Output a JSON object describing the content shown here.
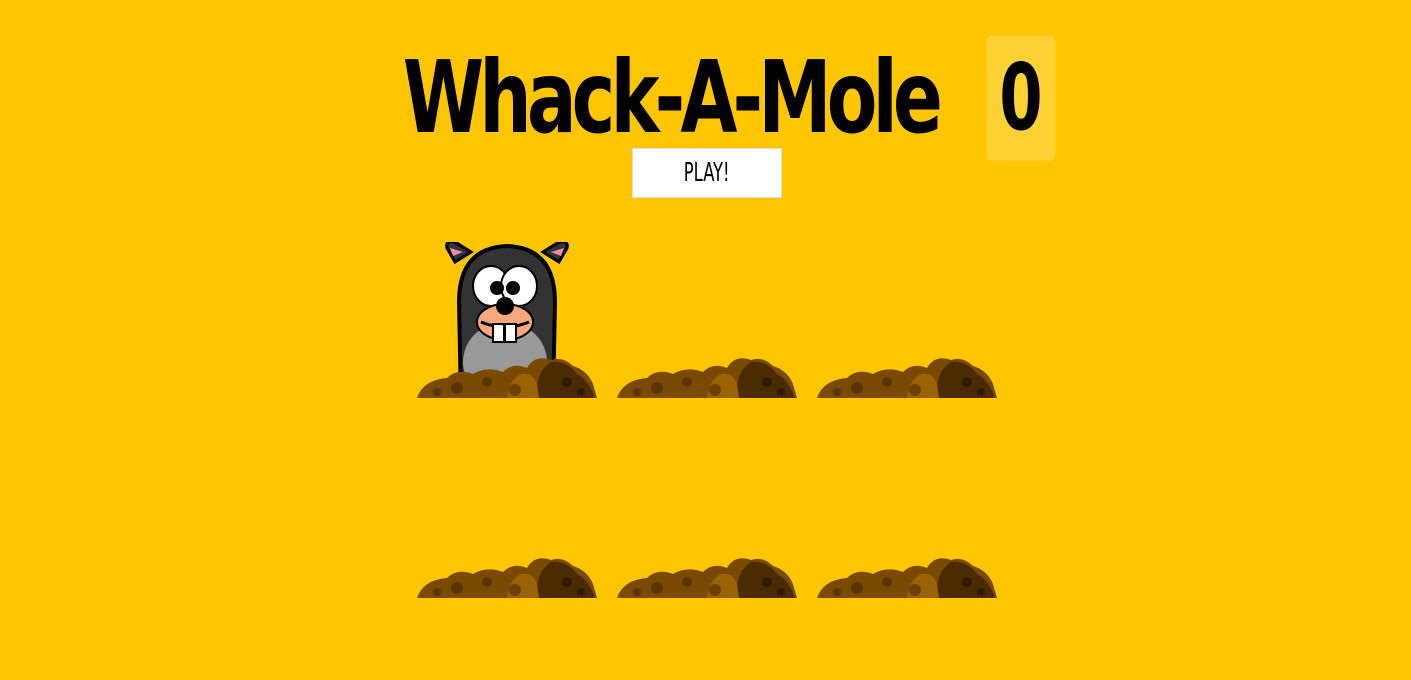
{
  "game": {
    "title": "Whack-A-Mole",
    "score": "0",
    "play_label": "PLAY!"
  },
  "holes": [
    {
      "id": 1,
      "mole_up": true
    },
    {
      "id": 2,
      "mole_up": false
    },
    {
      "id": 3,
      "mole_up": false
    },
    {
      "id": 4,
      "mole_up": false
    },
    {
      "id": 5,
      "mole_up": false
    },
    {
      "id": 6,
      "mole_up": false
    }
  ],
  "colors": {
    "background": "#ffc600",
    "dirt": "#7a4a00",
    "mole": "#333333"
  }
}
